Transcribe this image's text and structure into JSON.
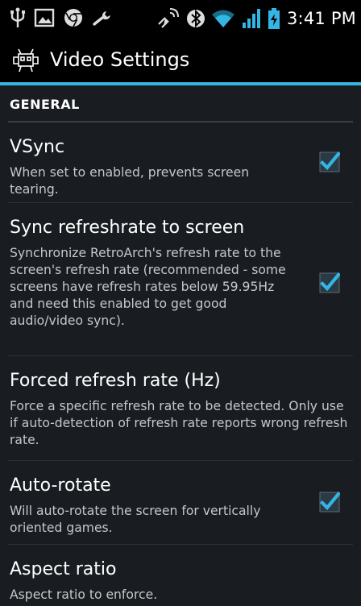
{
  "status_bar": {
    "time": "3:41 PM",
    "left_icons": [
      "usb-icon",
      "image-icon",
      "chrome-icon",
      "wrench-icon"
    ],
    "right_icons": [
      "nfc-icon",
      "bluetooth-icon",
      "wifi-icon",
      "signal-icon",
      "battery-charging-icon"
    ]
  },
  "action_bar": {
    "title": "Video Settings",
    "accent_color": "#33b5e5"
  },
  "section": {
    "label": "GENERAL"
  },
  "preferences": [
    {
      "title": "VSync",
      "summary": "When set to enabled, prevents screen tearing.",
      "checked": true
    },
    {
      "title": "Sync refreshrate to screen",
      "summary": "Synchronize RetroArch's refresh rate to the screen's refresh rate (recommended - some screens have refresh rates below 59.95Hz and need this enabled to get good audio/video sync).",
      "checked": true
    },
    {
      "title": "Forced refresh rate (Hz)",
      "summary": "Force a specific refresh rate to be detected. Only use if auto-detection of refresh rate reports wrong refresh rate."
    },
    {
      "title": "Auto-rotate",
      "summary": "Will auto-rotate the screen for vertically oriented games.",
      "checked": true
    },
    {
      "title": "Aspect ratio",
      "summary": "Aspect ratio to enforce."
    }
  ]
}
